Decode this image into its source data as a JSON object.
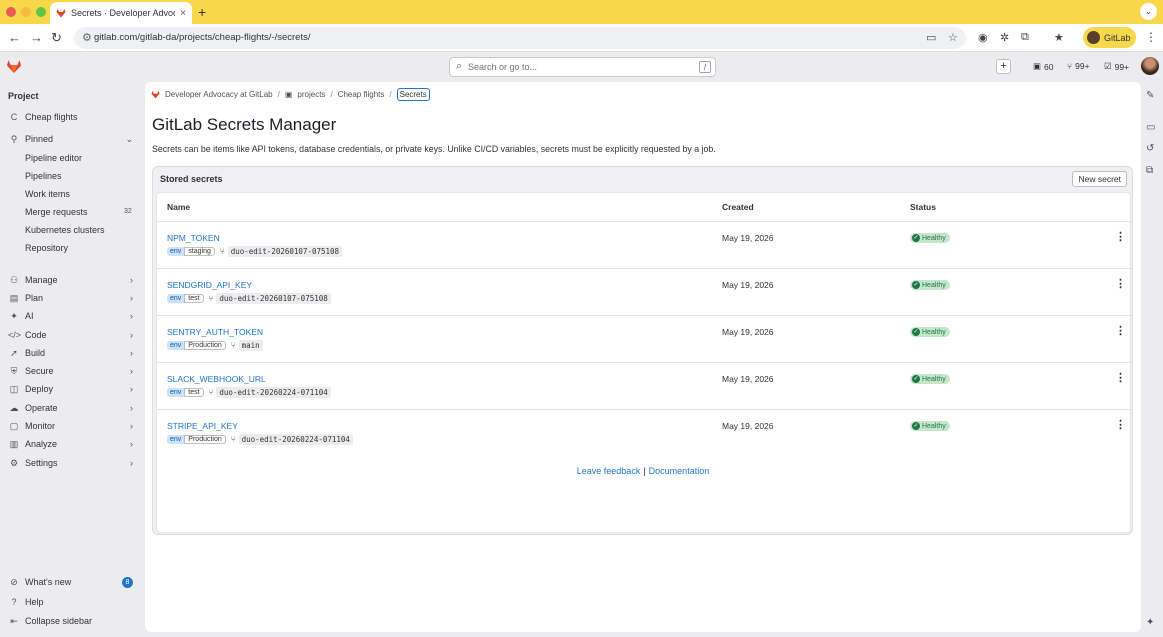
{
  "browser": {
    "tab_title": "Secrets · Developer Advocacy",
    "tab_close": "×",
    "new_tab": "+",
    "url": "gitlab.com/gitlab-da/projects/cheap-flights/-/secrets/",
    "profile_label": "GitLab"
  },
  "topbar": {
    "search_placeholder": "Search or go to...",
    "search_shortcut": "/",
    "issues_count": "60",
    "mr_count": "99+",
    "todo_count": "99+"
  },
  "sidebar": {
    "heading": "Project",
    "project_name": "Cheap flights",
    "pinned_label": "Pinned",
    "pinned_items": [
      {
        "label": "Pipeline editor"
      },
      {
        "label": "Pipelines"
      },
      {
        "label": "Work items"
      },
      {
        "label": "Merge requests",
        "count": "32"
      },
      {
        "label": "Kubernetes clusters"
      },
      {
        "label": "Repository"
      }
    ],
    "groups": [
      {
        "label": "Manage"
      },
      {
        "label": "Plan"
      },
      {
        "label": "AI"
      },
      {
        "label": "Code"
      },
      {
        "label": "Build"
      },
      {
        "label": "Secure"
      },
      {
        "label": "Deploy"
      },
      {
        "label": "Operate"
      },
      {
        "label": "Monitor"
      },
      {
        "label": "Analyze"
      },
      {
        "label": "Settings"
      }
    ],
    "whats_new": "What's new",
    "whats_new_count": "8",
    "help": "Help",
    "collapse": "Collapse sidebar"
  },
  "breadcrumb": {
    "items": [
      "Developer Advocacy at GitLab",
      "projects",
      "Cheap flights"
    ],
    "current": "Secrets"
  },
  "page": {
    "title": "GitLab Secrets Manager",
    "description": "Secrets can be items like API tokens, database credentials, or private keys. Unlike CI/CD variables, secrets must be explicitly requested by a job."
  },
  "secrets": {
    "card_title": "Stored secrets",
    "new_button": "New secret",
    "columns": {
      "name": "Name",
      "created": "Created",
      "status": "Status"
    },
    "env_label": "env",
    "rows": [
      {
        "name": "NPM_TOKEN",
        "env": "staging",
        "branch": "duo-edit-20260107-075108",
        "created": "May 19, 2026",
        "status": "Healthy"
      },
      {
        "name": "SENDGRID_API_KEY",
        "env": "test",
        "branch": "duo-edit-20260107-075108",
        "created": "May 19, 2026",
        "status": "Healthy"
      },
      {
        "name": "SENTRY_AUTH_TOKEN",
        "env": "Production",
        "branch": "main",
        "created": "May 19, 2026",
        "status": "Healthy"
      },
      {
        "name": "SLACK_WEBHOOK_URL",
        "env": "test",
        "branch": "duo-edit-20260224-071104",
        "created": "May 19, 2026",
        "status": "Healthy"
      },
      {
        "name": "STRIPE_API_KEY",
        "env": "Production",
        "branch": "duo-edit-20260224-071104",
        "created": "May 19, 2026",
        "status": "Healthy"
      }
    ]
  },
  "footer": {
    "feedback": "Leave feedback",
    "separator": "|",
    "docs": "Documentation"
  },
  "colors": {
    "browser_tabbar": "#f7d84a",
    "link": "#1f75cb",
    "healthy_bg": "#c3e6cd",
    "healthy_text": "#217645",
    "gitlab_orange": "#e24329"
  }
}
